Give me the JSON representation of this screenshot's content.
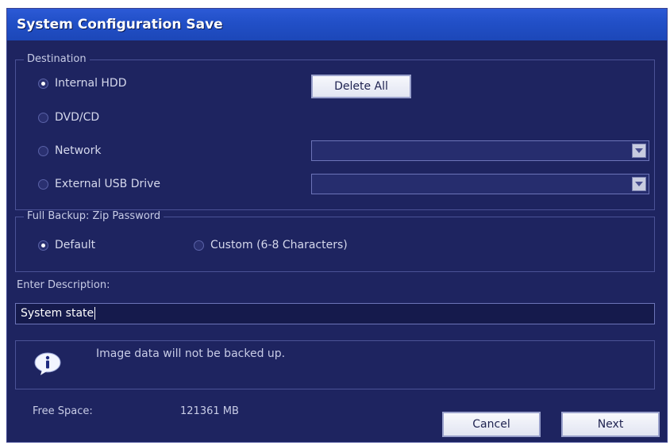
{
  "window": {
    "title": "System Configuration Save"
  },
  "destination": {
    "legend": "Destination",
    "options": [
      {
        "label": "Internal HDD",
        "checked": true
      },
      {
        "label": "DVD/CD",
        "checked": false
      },
      {
        "label": "Network",
        "checked": false
      },
      {
        "label": "External USB Drive",
        "checked": false
      }
    ],
    "delete_all_label": "Delete All"
  },
  "backup": {
    "legend": "Full Backup: Zip Password",
    "options": [
      {
        "label": "Default",
        "checked": true
      },
      {
        "label": "Custom (6-8 Characters)",
        "checked": false
      }
    ]
  },
  "description": {
    "label": "Enter Description:",
    "value": "System state"
  },
  "info": {
    "message": "Image data will not be backed up.",
    "icon": "info-icon"
  },
  "footer": {
    "free_space_label": "Free Space:",
    "free_space_value": "121361 MB",
    "cancel_label": "Cancel",
    "next_label": "Next"
  },
  "colors": {
    "window_bg": "#1e2460",
    "titlebar": "#2250c8",
    "text": "#c8cce6"
  }
}
